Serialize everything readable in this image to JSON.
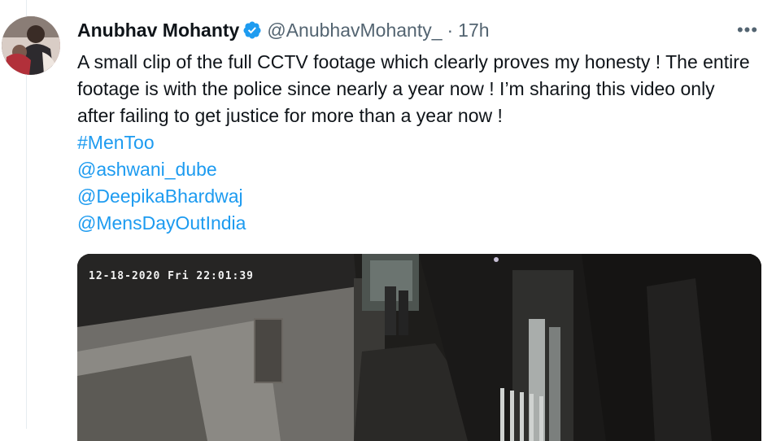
{
  "tweet": {
    "author": {
      "display_name": "Anubhav Mohanty",
      "handle": "@AnubhavMohanty_",
      "verified": true
    },
    "separator": "·",
    "time": "17h",
    "more_icon": "more-horizontal-icon",
    "text": "A small clip of the full CCTV footage which clearly proves my honesty ! The entire footage is with the police since nearly a year now ! I’m sharing this video only after failing to get justice for more than a year now !",
    "links": [
      "#MenToo",
      "@ashwani_dube",
      "@DeepikaBhardwaj",
      "@MensDayOutIndia"
    ],
    "media": {
      "cctv_timestamp": "12-18-2020 Fri 22:01:39"
    }
  },
  "colors": {
    "link": "#1d9bf0",
    "verified": "#1d9bf0",
    "secondary_text": "#536471"
  }
}
